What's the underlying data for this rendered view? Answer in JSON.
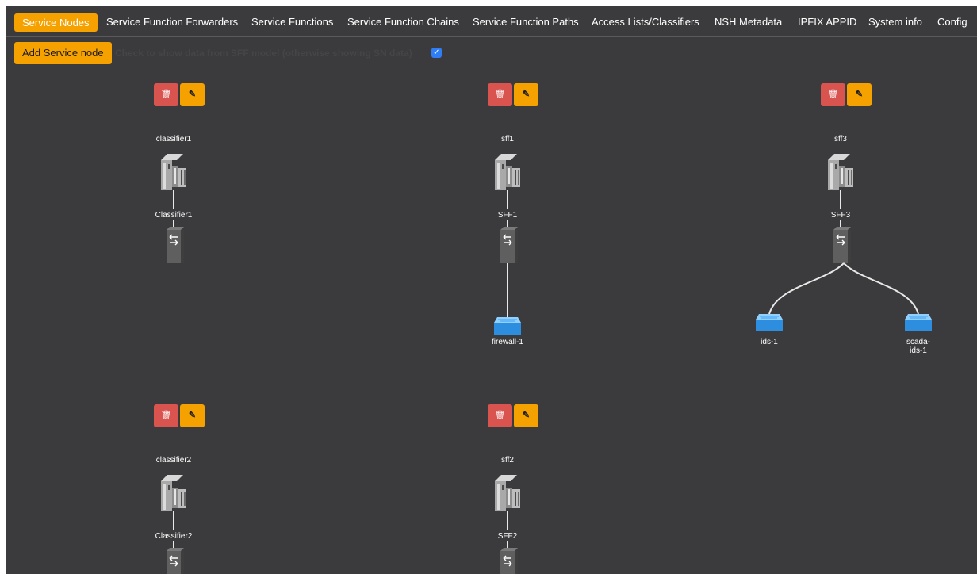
{
  "nav": {
    "items": [
      {
        "label": "Service Nodes",
        "active": true
      },
      {
        "label": "Service Function Forwarders"
      },
      {
        "label": "Service Functions"
      },
      {
        "label": "Service Function Chains"
      },
      {
        "label": "Service Function Paths"
      },
      {
        "label": "Access Lists/Classifiers"
      },
      {
        "label": "NSH Metadata"
      },
      {
        "label": "IPFIX APPID"
      },
      {
        "label": "System info"
      },
      {
        "label": "Config"
      }
    ]
  },
  "toolbar": {
    "add_label": "Add Service node",
    "sff_toggle_label": "Check to show data from SFF model (otherwise showing SN data)",
    "sff_toggle_checked": true
  },
  "icons": {
    "delete": "trash-icon",
    "edit": "edit-icon"
  },
  "nodes": [
    {
      "name": "classifier1",
      "forwarder": "Classifier1",
      "functions": []
    },
    {
      "name": "sff1",
      "forwarder": "SFF1",
      "functions": [
        "firewall-1"
      ]
    },
    {
      "name": "sff3",
      "forwarder": "SFF3",
      "functions": [
        "ids-1",
        "scada-\nids-1"
      ]
    },
    {
      "name": "classifier2",
      "forwarder": "Classifier2",
      "functions": []
    },
    {
      "name": "sff2",
      "forwarder": "SFF2",
      "functions": []
    }
  ],
  "colors": {
    "accent": "#f5a100",
    "danger": "#d9534f",
    "background": "#3b3b3d"
  }
}
